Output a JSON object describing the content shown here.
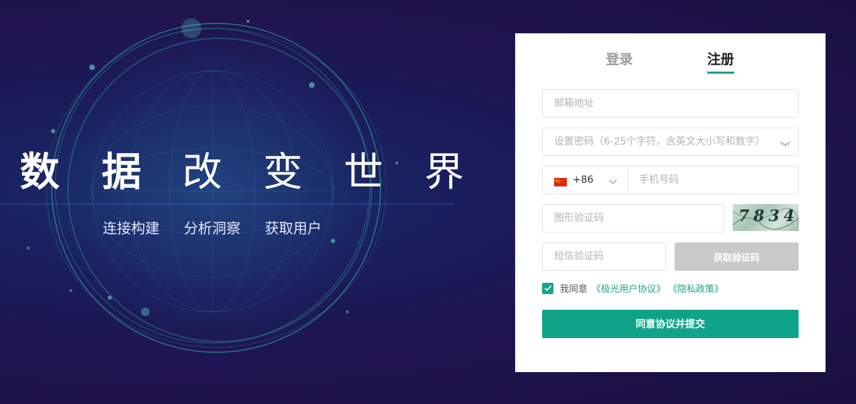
{
  "hero": {
    "headline_bold": "数 据",
    "headline_light": "改 变 世 界",
    "features": [
      "连接构建",
      "分析洞察",
      "获取用户"
    ]
  },
  "auth": {
    "tabs": {
      "login": "登录",
      "register": "注册",
      "active": "register"
    },
    "email_placeholder": "邮箱地址",
    "password_placeholder": "设置密码（6-25个字符，含英文大小写和数字）",
    "country_code": "+86",
    "phone_placeholder": "手机号码",
    "captcha_placeholder": "图形验证码",
    "captcha_text": "7834",
    "sms_placeholder": "短信验证码",
    "sms_button": "获取验证码",
    "agree_text": "我同意",
    "agree_checked": true,
    "terms_link": "《极光用户协议》",
    "privacy_link": "《隐私政策》",
    "submit_label": "同意协议并提交"
  },
  "colors": {
    "accent": "#0fa389",
    "disabled": "#c9c9c9",
    "background": "#1c1650"
  },
  "icons": {
    "password_toggle": "eye-closed-icon",
    "flag": "china-flag-icon",
    "dropdown": "chevron-down-icon",
    "checkbox": "check-icon"
  }
}
